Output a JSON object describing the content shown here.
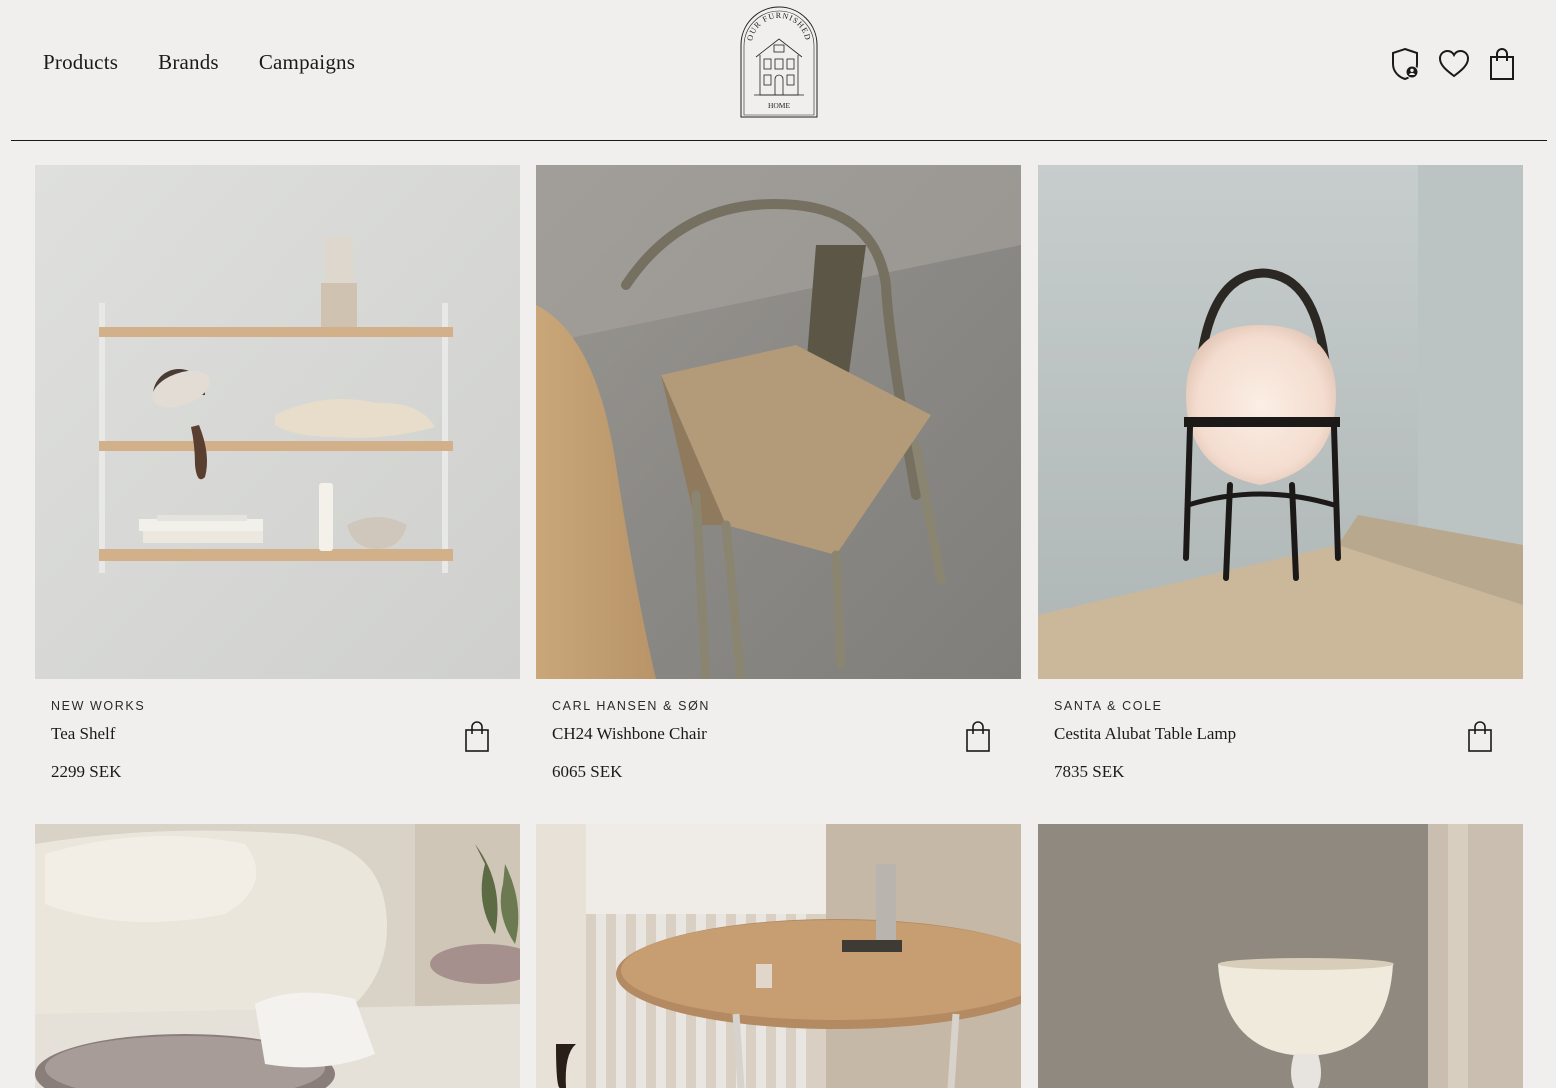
{
  "nav": {
    "products": "Products",
    "brands": "Brands",
    "campaigns": "Campaigns"
  },
  "logo": {
    "top_text": "OUR FURNISHED",
    "bottom_text": "HOME"
  },
  "header_icons": [
    "account-shield-icon",
    "heart-icon",
    "shopping-bag-icon"
  ],
  "products": [
    {
      "brand": "NEW WORKS",
      "name": "Tea Shelf",
      "price": "2299 SEK"
    },
    {
      "brand": "CARL HANSEN & SØN",
      "name": "CH24 Wishbone Chair",
      "price": "6065 SEK"
    },
    {
      "brand": "SANTA & COLE",
      "name": "Cestita Alubat Table Lamp",
      "price": "7835 SEK"
    }
  ],
  "colors": {
    "background": "#f0efed",
    "text": "#1a1a1a"
  }
}
